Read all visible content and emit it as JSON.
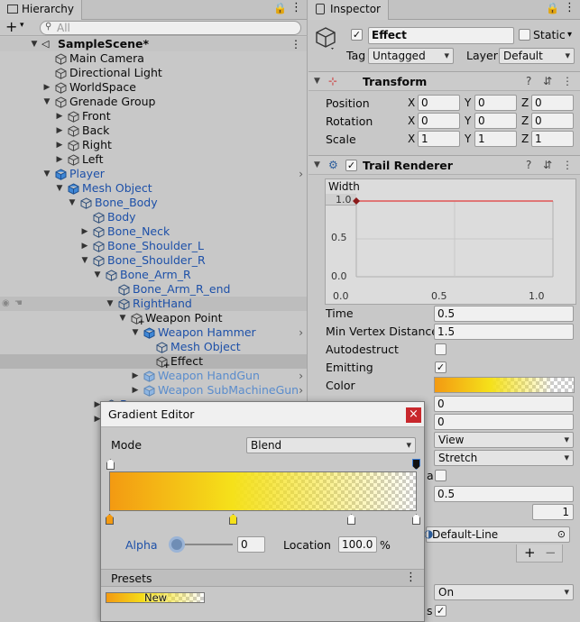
{
  "hierarchy": {
    "tab_label": "Hierarchy",
    "search_placeholder": "All",
    "add_label": "+",
    "scene_name": "SampleScene*",
    "rows": [
      {
        "label": "Main Camera"
      },
      {
        "label": "Directional Light"
      },
      {
        "label": "WorldSpace"
      },
      {
        "label": "Grenade Group"
      },
      {
        "label": "Front"
      },
      {
        "label": "Back"
      },
      {
        "label": "Right"
      },
      {
        "label": "Left"
      },
      {
        "label": "Player"
      },
      {
        "label": "Mesh Object"
      },
      {
        "label": "Bone_Body"
      },
      {
        "label": "Body"
      },
      {
        "label": "Bone_Neck"
      },
      {
        "label": "Bone_Shoulder_L"
      },
      {
        "label": "Bone_Shoulder_R"
      },
      {
        "label": "Bone_Arm_R"
      },
      {
        "label": "Bone_Arm_R_end"
      },
      {
        "label": "RightHand"
      },
      {
        "label": "Weapon Point"
      },
      {
        "label": "Weapon Hammer"
      },
      {
        "label": "Mesh Object"
      },
      {
        "label": "Effect"
      },
      {
        "label": "Weapon HandGun"
      },
      {
        "label": "Weapon SubMachineGun"
      },
      {
        "label": "B"
      },
      {
        "label": "B"
      }
    ]
  },
  "inspector": {
    "tab_label": "Inspector",
    "object_name": "Effect",
    "static_label": "Static",
    "tag_label": "Tag",
    "tag_value": "Untagged",
    "layer_label": "Layer",
    "layer_value": "Default",
    "transform": {
      "title": "Transform",
      "position_label": "Position",
      "rotation_label": "Rotation",
      "scale_label": "Scale",
      "axes": [
        "X",
        "Y",
        "Z"
      ],
      "position": [
        "0",
        "0",
        "0"
      ],
      "rotation": [
        "0",
        "0",
        "0"
      ],
      "scale": [
        "1",
        "1",
        "1"
      ]
    },
    "trail": {
      "title": "Trail Renderer",
      "width_label": "Width",
      "width_value": "1.0",
      "y_ticks": [
        "1.0",
        "0.5",
        "0.0"
      ],
      "x_ticks": [
        "0.0",
        "0.5",
        "1.0"
      ],
      "time_label": "Time",
      "time_value": "0.5",
      "minvd_label": "Min Vertex Distance",
      "minvd_value": "1.5",
      "autodestruct_label": "Autodestruct",
      "emitting_label": "Emitting",
      "color_label": "Color",
      "field_a": "0",
      "field_b": "0",
      "alignment_value": "View",
      "texture_mode_value": "Stretch",
      "partial_label": "a",
      "field_c": "0.5",
      "field_d": "1",
      "material_value": "Default-Line",
      "plus": "+",
      "minus": "−",
      "shadows_value": "On",
      "partial_label2": "s"
    }
  },
  "gradient_editor": {
    "title": "Gradient Editor",
    "close": "×",
    "mode_label": "Mode",
    "mode_value": "Blend",
    "alpha_label": "Alpha",
    "alpha_value": "0",
    "location_label": "Location",
    "location_value": "100.0",
    "percent": "%",
    "presets_label": "Presets",
    "new_label": "New"
  },
  "colors": {
    "gradient_start": "#f39a12",
    "gradient_mid": "#f5e11a",
    "gradient_end": "#ffffff",
    "link_blue": "#1d50a8",
    "close_red": "#c8272c"
  }
}
